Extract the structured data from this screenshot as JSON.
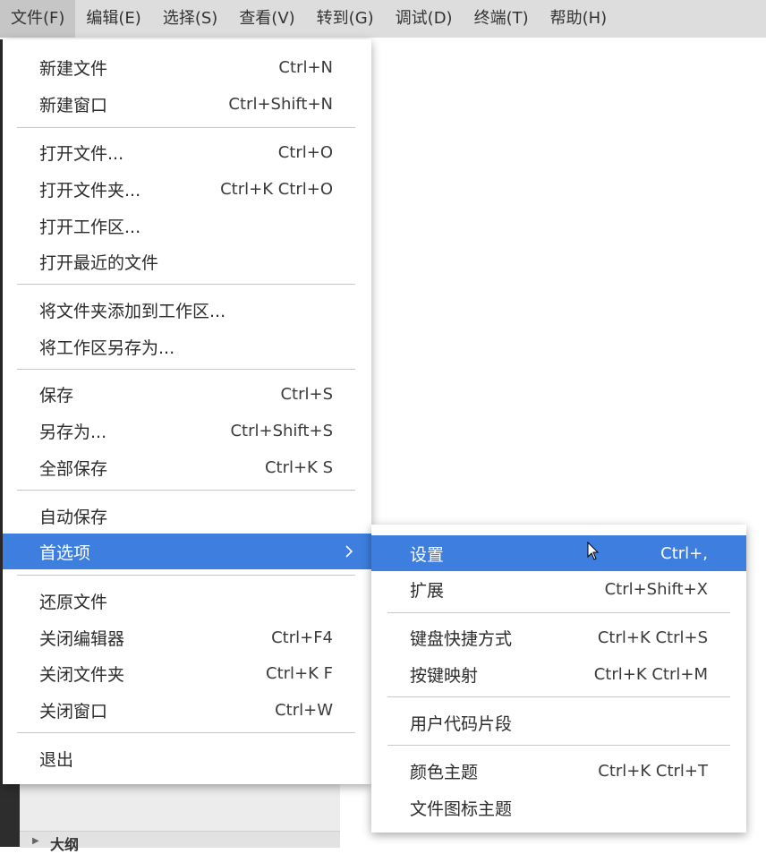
{
  "menubar": {
    "items": [
      "文件(F)",
      "编辑(E)",
      "选择(S)",
      "查看(V)",
      "转到(G)",
      "调试(D)",
      "终端(T)",
      "帮助(H)"
    ]
  },
  "file_menu": {
    "items": [
      {
        "label": "新建文件",
        "shortcut": "Ctrl+N"
      },
      {
        "label": "新建窗口",
        "shortcut": "Ctrl+Shift+N"
      },
      {
        "label": "打开文件...",
        "shortcut": "Ctrl+O"
      },
      {
        "label": "打开文件夹...",
        "shortcut": "Ctrl+K Ctrl+O"
      },
      {
        "label": "打开工作区...",
        "shortcut": ""
      },
      {
        "label": "打开最近的文件",
        "shortcut": ""
      },
      {
        "label": "将文件夹添加到工作区...",
        "shortcut": ""
      },
      {
        "label": "将工作区另存为...",
        "shortcut": ""
      },
      {
        "label": "保存",
        "shortcut": "Ctrl+S"
      },
      {
        "label": "另存为...",
        "shortcut": "Ctrl+Shift+S"
      },
      {
        "label": "全部保存",
        "shortcut": "Ctrl+K S"
      },
      {
        "label": "自动保存",
        "shortcut": ""
      },
      {
        "label": "首选项",
        "shortcut": ""
      },
      {
        "label": "还原文件",
        "shortcut": ""
      },
      {
        "label": "关闭编辑器",
        "shortcut": "Ctrl+F4"
      },
      {
        "label": "关闭文件夹",
        "shortcut": "Ctrl+K F"
      },
      {
        "label": "关闭窗口",
        "shortcut": "Ctrl+W"
      },
      {
        "label": "退出",
        "shortcut": ""
      }
    ]
  },
  "preferences_submenu": {
    "items": [
      {
        "label": "设置",
        "shortcut": "Ctrl+,"
      },
      {
        "label": "扩展",
        "shortcut": "Ctrl+Shift+X"
      },
      {
        "label": "键盘快捷方式",
        "shortcut": "Ctrl+K Ctrl+S"
      },
      {
        "label": "按键映射",
        "shortcut": "Ctrl+K Ctrl+M"
      },
      {
        "label": "用户代码片段",
        "shortcut": ""
      },
      {
        "label": "颜色主题",
        "shortcut": "Ctrl+K Ctrl+T"
      },
      {
        "label": "文件图标主题",
        "shortcut": ""
      }
    ]
  },
  "sidebar": {
    "outline_label": "大纲"
  },
  "colors": {
    "highlight": "#3d7ede",
    "menubar_bg": "#dddddd",
    "menubar_active": "#c6c6c6"
  }
}
